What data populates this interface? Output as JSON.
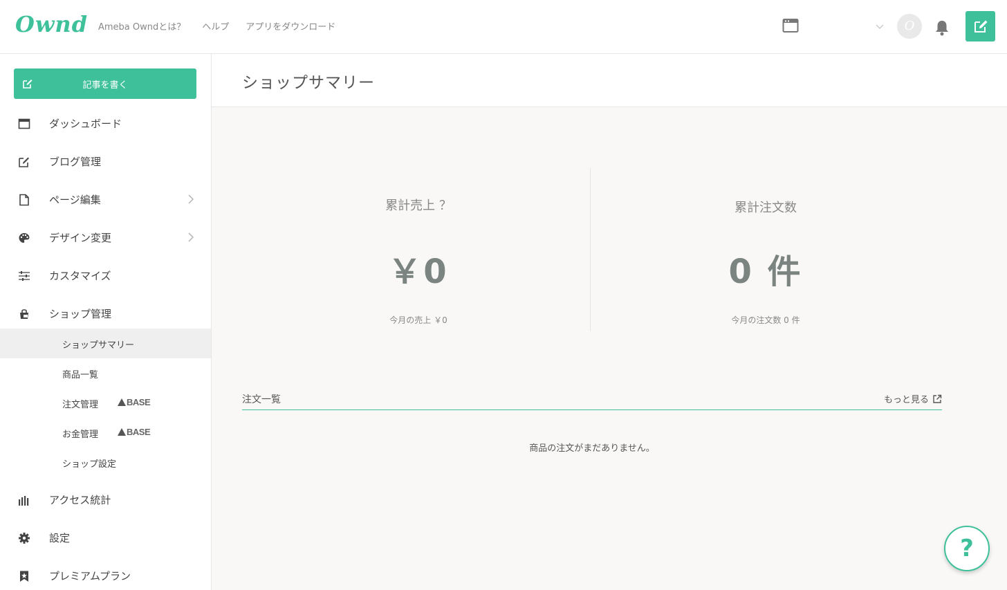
{
  "app": {
    "logo_text": "Ownd",
    "brand_color": "#3ec19a"
  },
  "header": {
    "nav": [
      "Ameba Owndとは？",
      "ヘルプ",
      "アプリをダウンロード"
    ],
    "avatar_letter": "O",
    "icons": [
      "site-window-icon",
      "chevron-down-icon",
      "bell-icon",
      "edit-icon"
    ]
  },
  "sidebar": {
    "write_button": "記事を書く",
    "items": [
      {
        "label": "ダッシュボード",
        "icon": "dashboard-icon"
      },
      {
        "label": "ブログ管理",
        "icon": "edit-icon"
      },
      {
        "label": "ページ編集",
        "icon": "page-icon",
        "has_chevron": true
      },
      {
        "label": "デザイン変更",
        "icon": "palette-icon",
        "has_chevron": true
      },
      {
        "label": "カスタマイズ",
        "icon": "sliders-icon"
      },
      {
        "label": "ショップ管理",
        "icon": "shop-bag-icon"
      }
    ],
    "shop_sub": [
      {
        "label": "ショップサマリー",
        "active": true
      },
      {
        "label": "商品一覧"
      },
      {
        "label": "注文管理",
        "badge": "BASE"
      },
      {
        "label": "お金管理",
        "badge": "BASE"
      },
      {
        "label": "ショップ設定"
      }
    ],
    "bottom_items": [
      {
        "label": "アクセス統計",
        "icon": "bar-chart-icon"
      },
      {
        "label": "設定",
        "icon": "gear-icon"
      },
      {
        "label": "プレミアムプラン",
        "icon": "star-bookmark-icon"
      }
    ]
  },
  "page": {
    "title": "ショップサマリー"
  },
  "stats": {
    "sales": {
      "label": "累計売上 ？",
      "value": "￥0",
      "monthly": "今月の売上 ￥0"
    },
    "orders": {
      "label": "累計注文数",
      "value": "0 件",
      "monthly": "今月の注文数 0 件"
    }
  },
  "orders": {
    "title": "注文一覧",
    "more_link": "もっと見る",
    "empty_message": "商品の注文がまだありません。"
  },
  "help_button": "?"
}
